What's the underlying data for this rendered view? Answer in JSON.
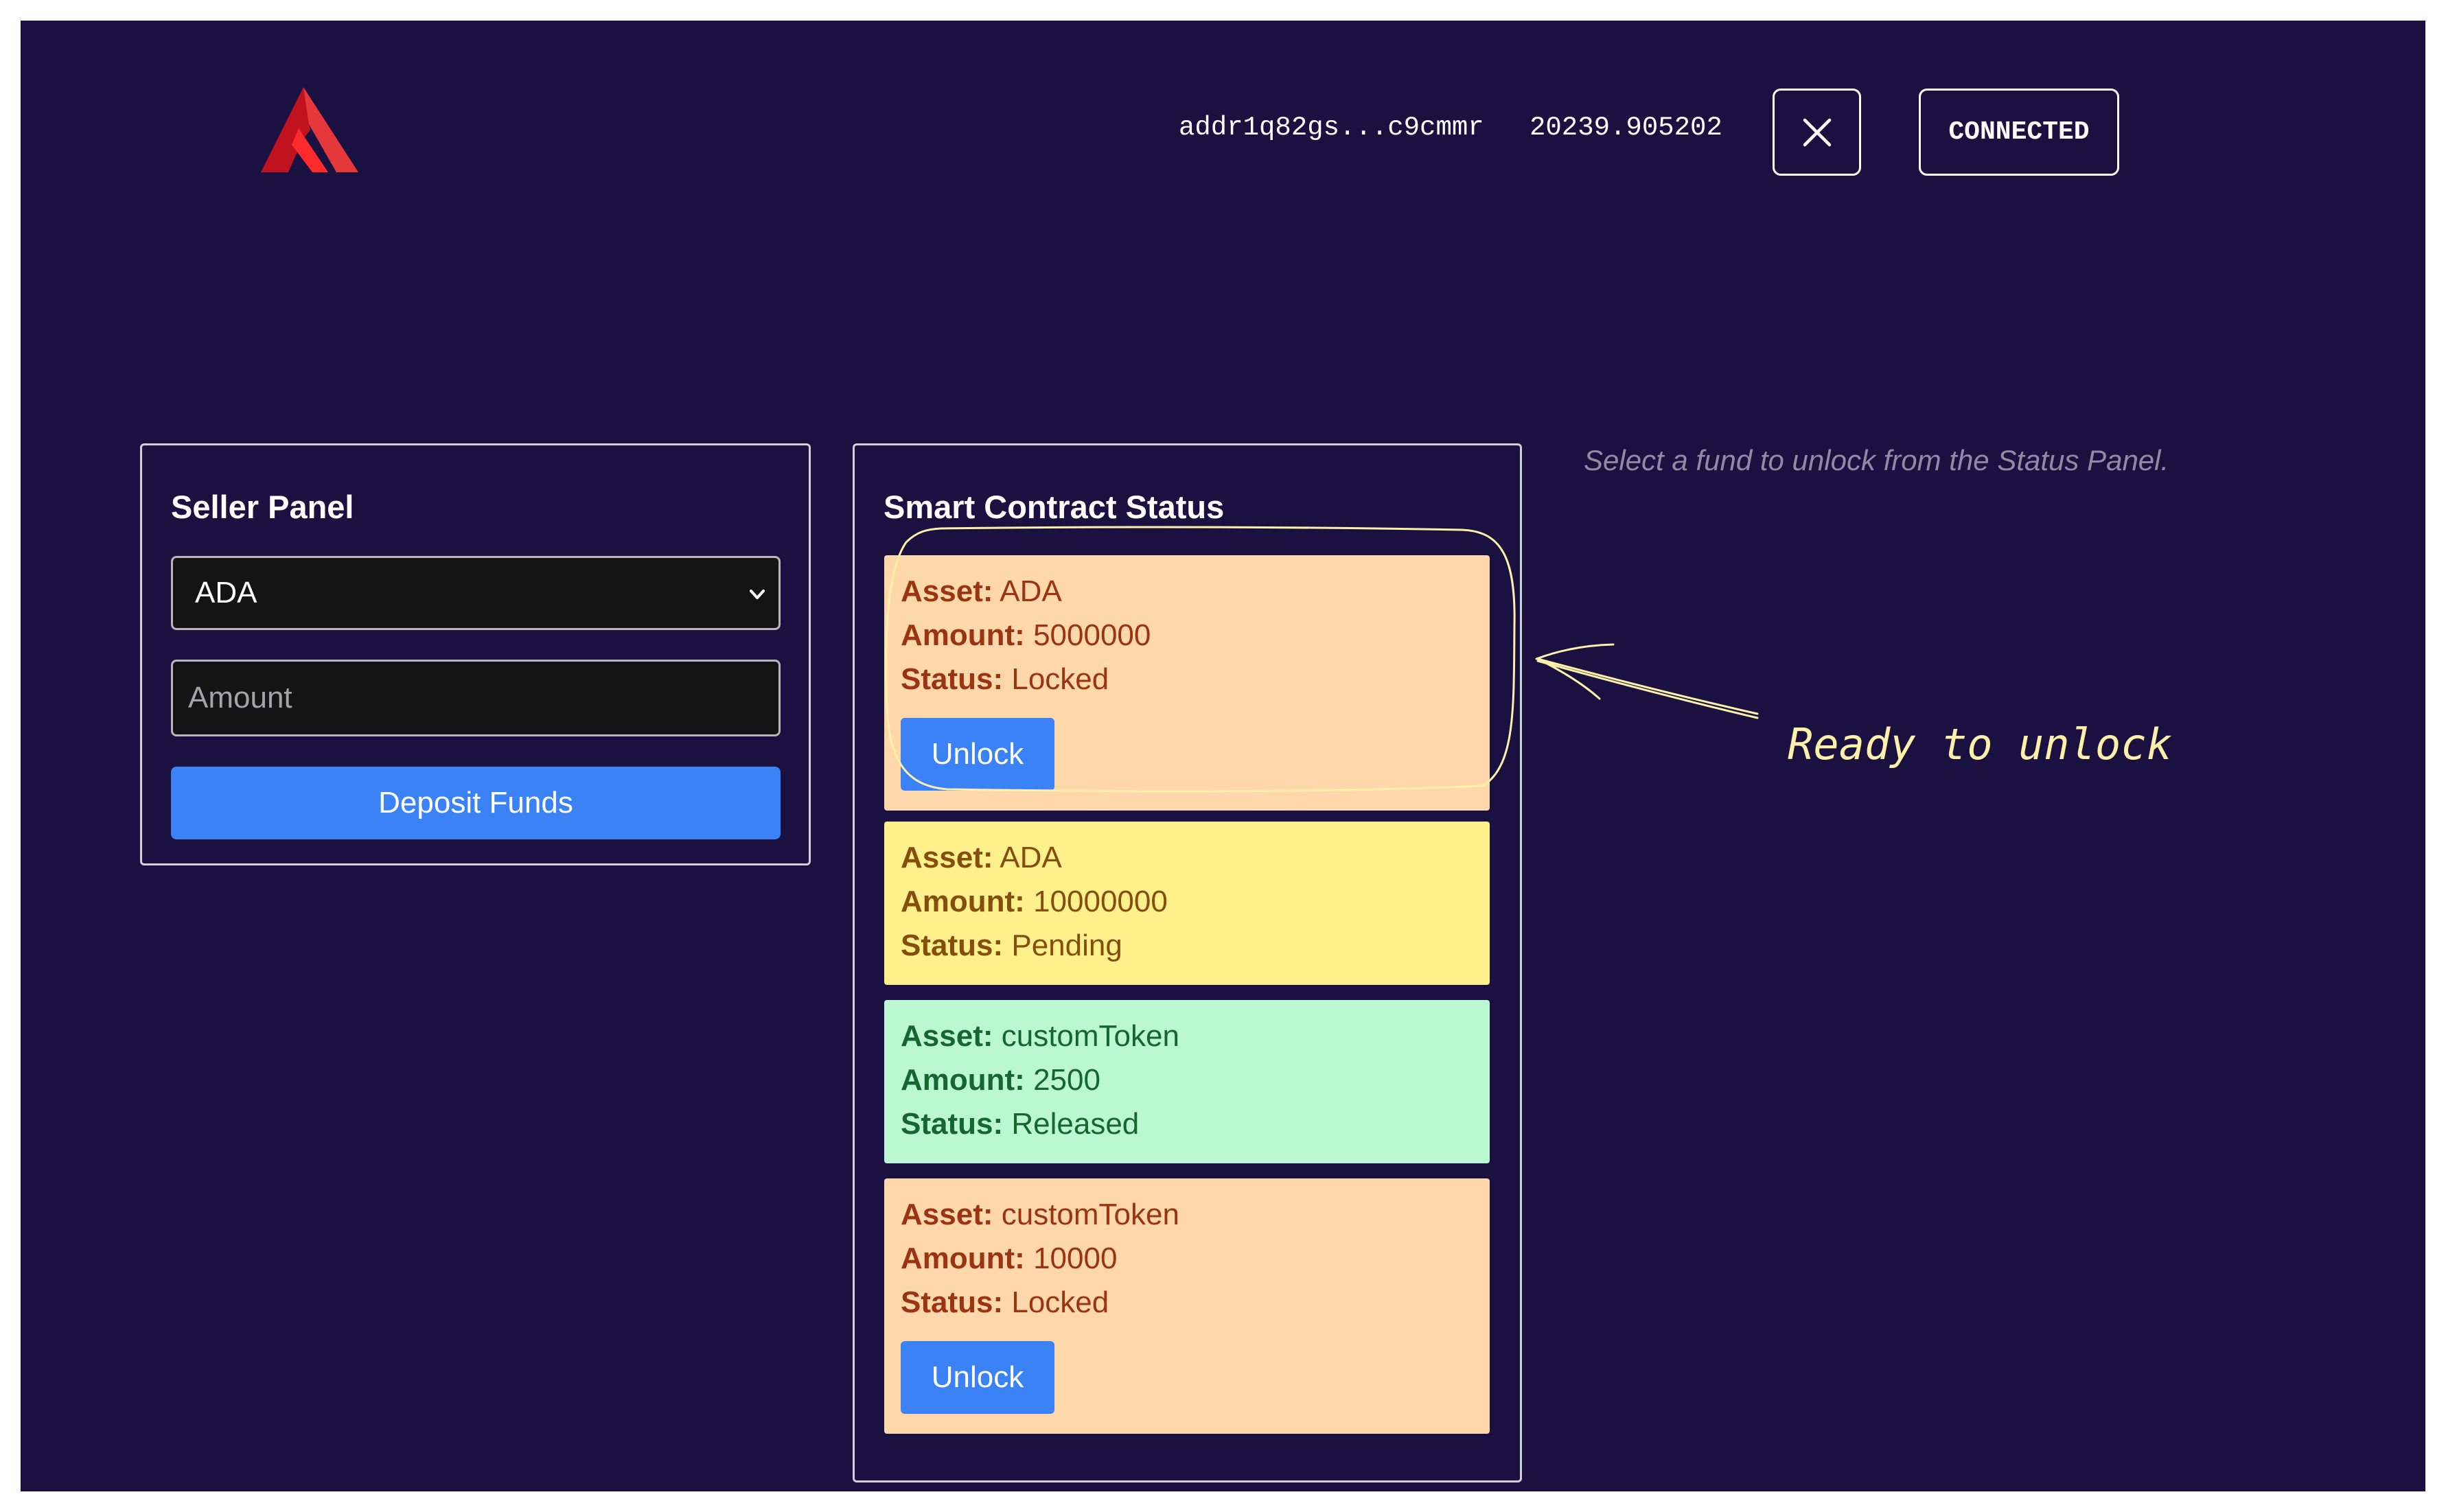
{
  "header": {
    "wallet_address": "addr1q82gs...c9cmmr",
    "wallet_balance": "20239.905202",
    "connected_label": "CONNECTED",
    "logo_icon": "red-a-logo",
    "disconnect_icon": "close-icon"
  },
  "seller_panel": {
    "title": "Seller Panel",
    "asset_selected": "ADA",
    "amount_placeholder": "Amount",
    "deposit_label": "Deposit Funds"
  },
  "status_panel": {
    "title": "Smart Contract Status",
    "field_labels": {
      "asset": "Asset:",
      "amount": "Amount:",
      "status": "Status:"
    },
    "funds": [
      {
        "asset": "ADA",
        "amount": "5000000",
        "status": "Locked",
        "action": "Unlock"
      },
      {
        "asset": "ADA",
        "amount": "10000000",
        "status": "Pending"
      },
      {
        "asset": "customToken",
        "amount": "2500",
        "status": "Released"
      },
      {
        "asset": "customToken",
        "amount": "10000",
        "status": "Locked",
        "action": "Unlock"
      }
    ]
  },
  "hint": "Select a fund to unlock from the Status Panel.",
  "annotation": {
    "text": "Ready to unlock"
  },
  "colors": {
    "background": "#1b1140",
    "primary_button": "#3b82f6",
    "locked_card": "#fed7aa",
    "pending_card": "#fef08a",
    "released_card": "#bbf7d0",
    "annotation": "#fdf0a8",
    "logo": "#e01b1b"
  }
}
